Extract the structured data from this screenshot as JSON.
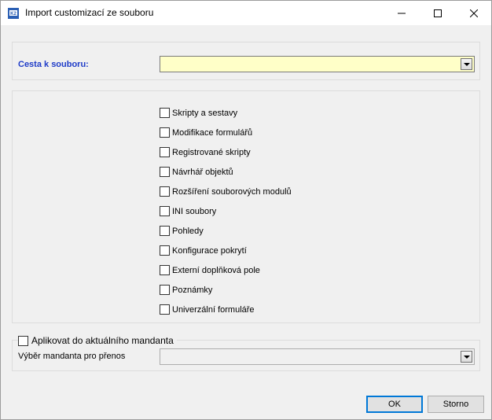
{
  "window": {
    "title": "Import customizací ze souboru"
  },
  "path": {
    "label": "Cesta k souboru:",
    "value": ""
  },
  "options": [
    {
      "label": "Skripty a sestavy",
      "checked": false
    },
    {
      "label": "Modifikace formulářů",
      "checked": false
    },
    {
      "label": "Registrované skripty",
      "checked": false
    },
    {
      "label": "Návrhář objektů",
      "checked": false
    },
    {
      "label": "Rozšíření souborových modulů",
      "checked": false
    },
    {
      "label": "INI soubory",
      "checked": false
    },
    {
      "label": "Pohledy",
      "checked": false
    },
    {
      "label": "Konfigurace pokrytí",
      "checked": false
    },
    {
      "label": "Externí doplňková pole",
      "checked": false
    },
    {
      "label": "Poznámky",
      "checked": false
    },
    {
      "label": "Univerzální formuláře",
      "checked": false
    }
  ],
  "tenant": {
    "apply_label": "Aplikovat do aktuálního mandanta",
    "apply_checked": false,
    "select_label": "Výběr mandanta pro přenos",
    "select_value": ""
  },
  "buttons": {
    "ok": "OK",
    "cancel": "Storno"
  },
  "colors": {
    "path_label": "#1f3cc8",
    "path_field_bg": "#ffffc8",
    "ok_border": "#0078d7"
  }
}
